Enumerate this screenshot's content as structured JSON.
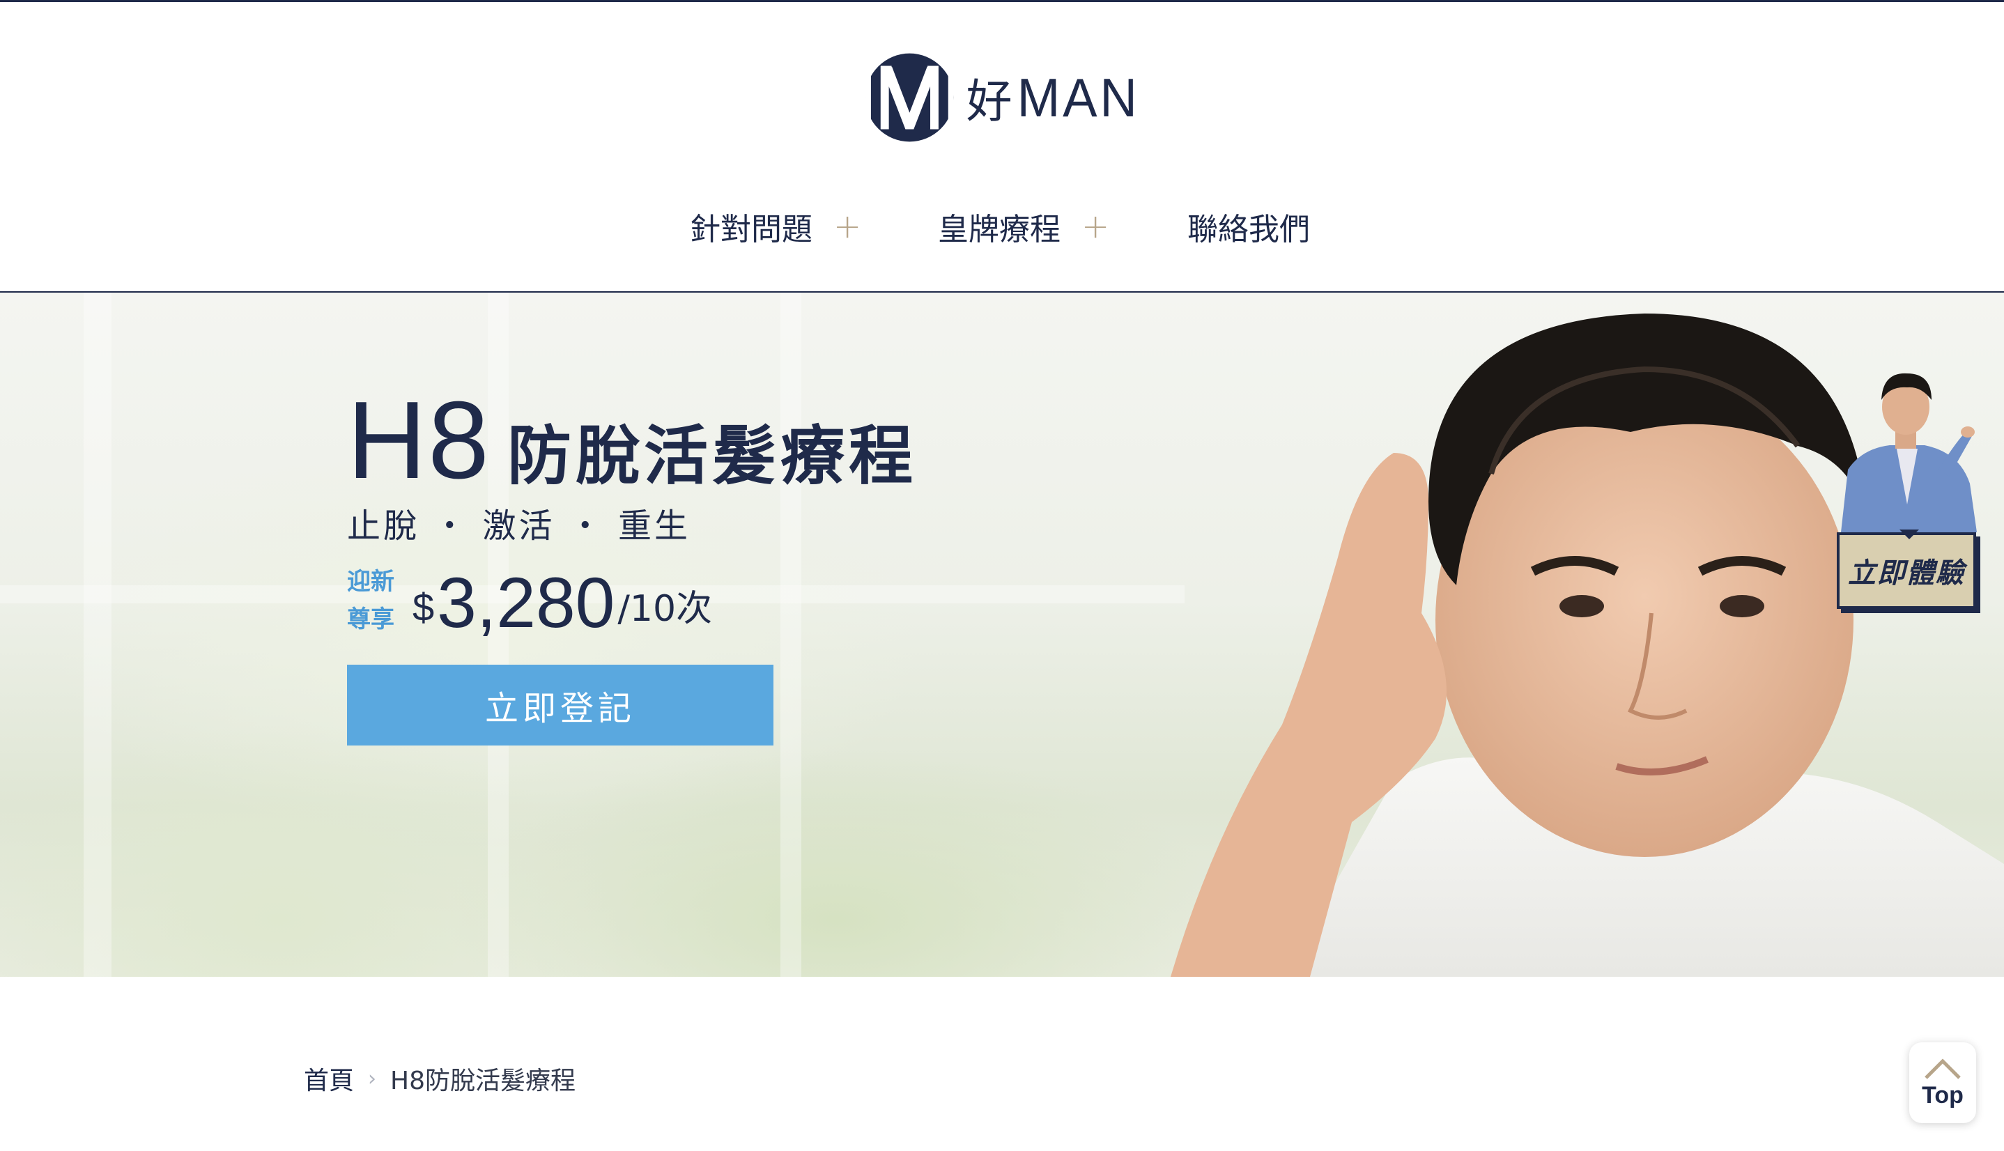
{
  "brand": {
    "logo_zh": "好",
    "logo_en": "MAN",
    "color_navy": "#1f2a4a",
    "color_accent": "#5aa8df",
    "color_gold": "#b7a58a"
  },
  "nav": {
    "items": [
      {
        "label": "針對問題",
        "has_submenu": true,
        "submenu_icon": "plus-icon"
      },
      {
        "label": "皇牌療程",
        "has_submenu": true,
        "submenu_icon": "plus-icon"
      },
      {
        "label": "聯絡我們",
        "has_submenu": false
      }
    ]
  },
  "hero": {
    "title_code": "H8",
    "title_zh": "防脫活髮療程",
    "subtitle": "止脫 ・ 激活 ・ 重生",
    "price_tag_line1": "迎新",
    "price_tag_line2": "尊享",
    "price_currency": "$",
    "price_amount": "3,280",
    "price_unit": "/10次",
    "cta_label": "立即登記"
  },
  "promo": {
    "label": "立即體驗"
  },
  "breadcrumb": {
    "home": "首頁",
    "separator_icon": "chevron-right-icon",
    "current": "H8防脫活髮療程"
  },
  "back_to_top": {
    "label": "Top",
    "icon": "chevron-up-icon"
  }
}
